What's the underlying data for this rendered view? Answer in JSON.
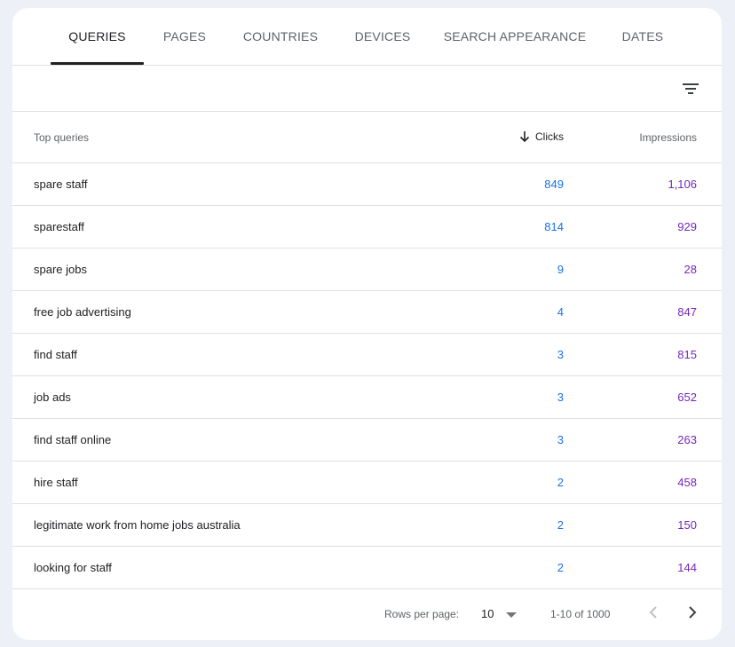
{
  "tabs": [
    {
      "label": "QUERIES",
      "active": true
    },
    {
      "label": "PAGES",
      "active": false
    },
    {
      "label": "COUNTRIES",
      "active": false
    },
    {
      "label": "DEVICES",
      "active": false
    },
    {
      "label": "SEARCH APPEARANCE",
      "active": false
    },
    {
      "label": "DATES",
      "active": false
    }
  ],
  "table": {
    "headers": {
      "query": "Top queries",
      "clicks": "Clicks",
      "impressions": "Impressions",
      "sort_icon": "arrow-down-icon"
    },
    "rows": [
      {
        "query": "spare staff",
        "clicks": "849",
        "impressions": "1,106"
      },
      {
        "query": "sparestaff",
        "clicks": "814",
        "impressions": "929"
      },
      {
        "query": "spare jobs",
        "clicks": "9",
        "impressions": "28"
      },
      {
        "query": "free job advertising",
        "clicks": "4",
        "impressions": "847"
      },
      {
        "query": "find staff",
        "clicks": "3",
        "impressions": "815"
      },
      {
        "query": "job ads",
        "clicks": "3",
        "impressions": "652"
      },
      {
        "query": "find staff online",
        "clicks": "3",
        "impressions": "263"
      },
      {
        "query": "hire staff",
        "clicks": "2",
        "impressions": "458"
      },
      {
        "query": "legitimate work from home jobs australia",
        "clicks": "2",
        "impressions": "150"
      },
      {
        "query": "looking for staff",
        "clicks": "2",
        "impressions": "144"
      }
    ]
  },
  "pagination": {
    "rows_per_page_label": "Rows per page:",
    "rows_per_page_value": "10",
    "range": "1-10 of 1000"
  },
  "colors": {
    "clicks": "#1a73e8",
    "impressions": "#7627bb",
    "background": "#eef0f8"
  },
  "icons": {
    "filter": "filter-icon",
    "prev": "chevron-left-icon",
    "next": "chevron-right-icon",
    "dropdown": "caret-down-icon"
  }
}
